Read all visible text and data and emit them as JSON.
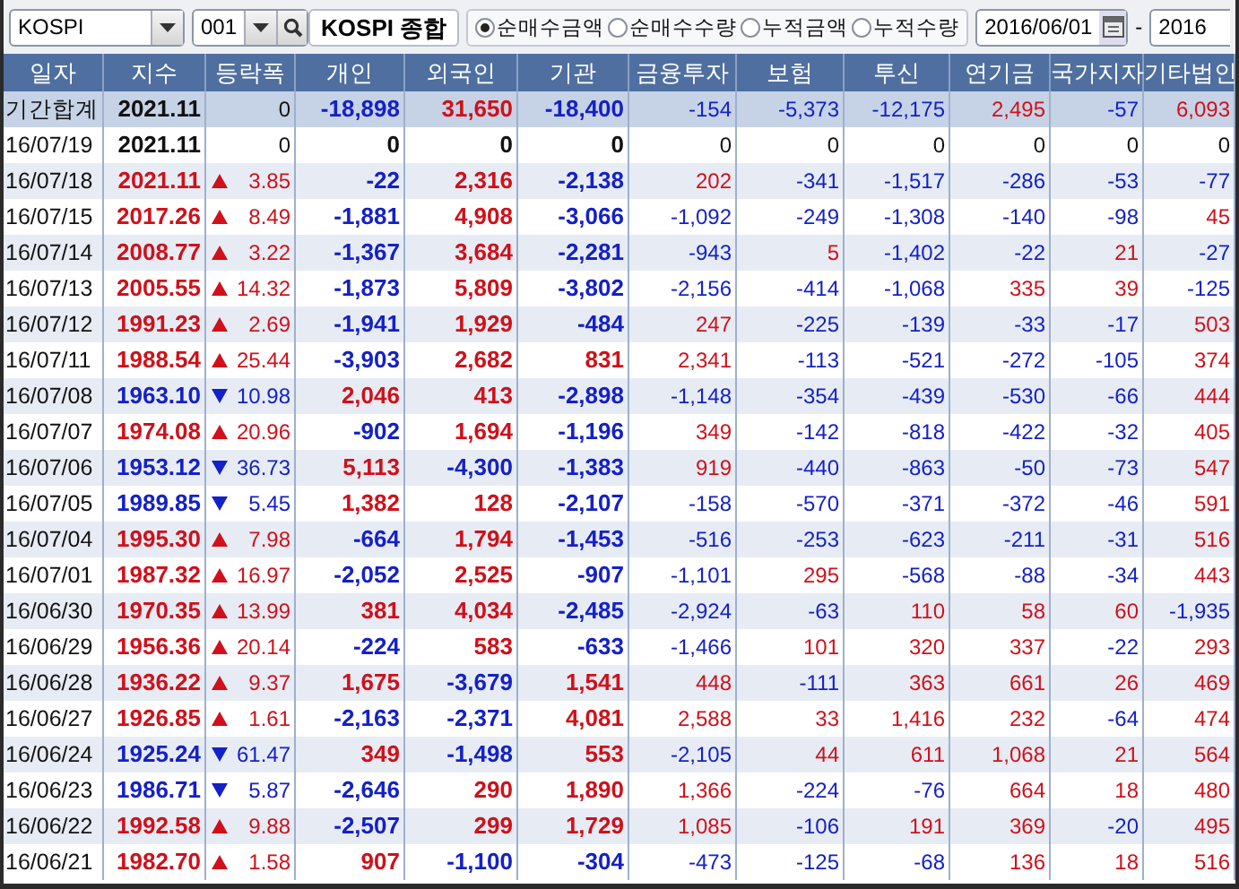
{
  "toolbar": {
    "market": "KOSPI",
    "code": "001",
    "name": "KOSPI 종합",
    "options": [
      {
        "label": "순매수금액",
        "selected": true
      },
      {
        "label": "순매수수량",
        "selected": false
      },
      {
        "label": "누적금액",
        "selected": false
      },
      {
        "label": "누적수량",
        "selected": false
      }
    ],
    "start_date": "2016/06/01",
    "separator": "-",
    "end_date": "2016"
  },
  "table": {
    "columns": [
      "일자",
      "지수",
      "등락폭",
      "개인",
      "외국인",
      "기관",
      "금융투자",
      "보험",
      "투신",
      "연기금",
      "국가지자",
      "기타법인"
    ],
    "rows": [
      {
        "kind": "total",
        "date": "기간합계",
        "index": "2021.11",
        "change": {
          "kind": "flat",
          "value": "0"
        },
        "values": [
          "-18,898",
          "31,650",
          "-18,400",
          "-154",
          "-5,373",
          "-12,175",
          "2,495",
          "-57",
          "6,093"
        ]
      },
      {
        "kind": "day",
        "date": "16/07/19",
        "index": "2021.11",
        "change": {
          "kind": "flat",
          "value": "0"
        },
        "values": [
          "0",
          "0",
          "0",
          "0",
          "0",
          "0",
          "0",
          "0",
          "0"
        ]
      },
      {
        "kind": "day",
        "date": "16/07/18",
        "index": "2021.11",
        "change": {
          "kind": "up",
          "value": "3.85"
        },
        "values": [
          "-22",
          "2,316",
          "-2,138",
          "202",
          "-341",
          "-1,517",
          "-286",
          "-53",
          "-77"
        ]
      },
      {
        "kind": "day",
        "date": "16/07/15",
        "index": "2017.26",
        "change": {
          "kind": "up",
          "value": "8.49"
        },
        "values": [
          "-1,881",
          "4,908",
          "-3,066",
          "-1,092",
          "-249",
          "-1,308",
          "-140",
          "-98",
          "45"
        ]
      },
      {
        "kind": "day",
        "date": "16/07/14",
        "index": "2008.77",
        "change": {
          "kind": "up",
          "value": "3.22"
        },
        "values": [
          "-1,367",
          "3,684",
          "-2,281",
          "-943",
          "5",
          "-1,402",
          "-22",
          "21",
          "-27"
        ]
      },
      {
        "kind": "day",
        "date": "16/07/13",
        "index": "2005.55",
        "change": {
          "kind": "up",
          "value": "14.32"
        },
        "values": [
          "-1,873",
          "5,809",
          "-3,802",
          "-2,156",
          "-414",
          "-1,068",
          "335",
          "39",
          "-125"
        ]
      },
      {
        "kind": "day",
        "date": "16/07/12",
        "index": "1991.23",
        "change": {
          "kind": "up",
          "value": "2.69"
        },
        "values": [
          "-1,941",
          "1,929",
          "-484",
          "247",
          "-225",
          "-139",
          "-33",
          "-17",
          "503"
        ]
      },
      {
        "kind": "day",
        "date": "16/07/11",
        "index": "1988.54",
        "change": {
          "kind": "up",
          "value": "25.44"
        },
        "values": [
          "-3,903",
          "2,682",
          "831",
          "2,341",
          "-113",
          "-521",
          "-272",
          "-105",
          "374"
        ]
      },
      {
        "kind": "day",
        "date": "16/07/08",
        "index": "1963.10",
        "change": {
          "kind": "down",
          "value": "10.98"
        },
        "values": [
          "2,046",
          "413",
          "-2,898",
          "-1,148",
          "-354",
          "-439",
          "-530",
          "-66",
          "444"
        ]
      },
      {
        "kind": "day",
        "date": "16/07/07",
        "index": "1974.08",
        "change": {
          "kind": "up",
          "value": "20.96"
        },
        "values": [
          "-902",
          "1,694",
          "-1,196",
          "349",
          "-142",
          "-818",
          "-422",
          "-32",
          "405"
        ]
      },
      {
        "kind": "day",
        "date": "16/07/06",
        "index": "1953.12",
        "change": {
          "kind": "down",
          "value": "36.73"
        },
        "values": [
          "5,113",
          "-4,300",
          "-1,383",
          "919",
          "-440",
          "-863",
          "-50",
          "-73",
          "547"
        ]
      },
      {
        "kind": "day",
        "date": "16/07/05",
        "index": "1989.85",
        "change": {
          "kind": "down",
          "value": "5.45"
        },
        "values": [
          "1,382",
          "128",
          "-2,107",
          "-158",
          "-570",
          "-371",
          "-372",
          "-46",
          "591"
        ]
      },
      {
        "kind": "day",
        "date": "16/07/04",
        "index": "1995.30",
        "change": {
          "kind": "up",
          "value": "7.98"
        },
        "values": [
          "-664",
          "1,794",
          "-1,453",
          "-516",
          "-253",
          "-623",
          "-211",
          "-31",
          "516"
        ]
      },
      {
        "kind": "day",
        "date": "16/07/01",
        "index": "1987.32",
        "change": {
          "kind": "up",
          "value": "16.97"
        },
        "values": [
          "-2,052",
          "2,525",
          "-907",
          "-1,101",
          "295",
          "-568",
          "-88",
          "-34",
          "443"
        ]
      },
      {
        "kind": "day",
        "date": "16/06/30",
        "index": "1970.35",
        "change": {
          "kind": "up",
          "value": "13.99"
        },
        "values": [
          "381",
          "4,034",
          "-2,485",
          "-2,924",
          "-63",
          "110",
          "58",
          "60",
          "-1,935"
        ]
      },
      {
        "kind": "day",
        "date": "16/06/29",
        "index": "1956.36",
        "change": {
          "kind": "up",
          "value": "20.14"
        },
        "values": [
          "-224",
          "583",
          "-633",
          "-1,466",
          "101",
          "320",
          "337",
          "-22",
          "293"
        ]
      },
      {
        "kind": "day",
        "date": "16/06/28",
        "index": "1936.22",
        "change": {
          "kind": "up",
          "value": "9.37"
        },
        "values": [
          "1,675",
          "-3,679",
          "1,541",
          "448",
          "-111",
          "363",
          "661",
          "26",
          "469"
        ]
      },
      {
        "kind": "day",
        "date": "16/06/27",
        "index": "1926.85",
        "change": {
          "kind": "up",
          "value": "1.61"
        },
        "values": [
          "-2,163",
          "-2,371",
          "4,081",
          "2,588",
          "33",
          "1,416",
          "232",
          "-64",
          "474"
        ]
      },
      {
        "kind": "day",
        "date": "16/06/24",
        "index": "1925.24",
        "change": {
          "kind": "down",
          "value": "61.47"
        },
        "values": [
          "349",
          "-1,498",
          "553",
          "-2,105",
          "44",
          "611",
          "1,068",
          "21",
          "564"
        ]
      },
      {
        "kind": "day",
        "date": "16/06/23",
        "index": "1986.71",
        "change": {
          "kind": "down",
          "value": "5.87"
        },
        "values": [
          "-2,646",
          "290",
          "1,890",
          "1,366",
          "-224",
          "-76",
          "664",
          "18",
          "480"
        ]
      },
      {
        "kind": "day",
        "date": "16/06/22",
        "index": "1992.58",
        "change": {
          "kind": "up",
          "value": "9.88"
        },
        "values": [
          "-2,507",
          "299",
          "1,729",
          "1,085",
          "-106",
          "191",
          "369",
          "-20",
          "495"
        ]
      },
      {
        "kind": "day",
        "date": "16/06/21",
        "index": "1982.70",
        "change": {
          "kind": "up",
          "value": "1.58"
        },
        "values": [
          "907",
          "-1,100",
          "-304",
          "-473",
          "-125",
          "-68",
          "136",
          "18",
          "516"
        ]
      }
    ]
  }
}
